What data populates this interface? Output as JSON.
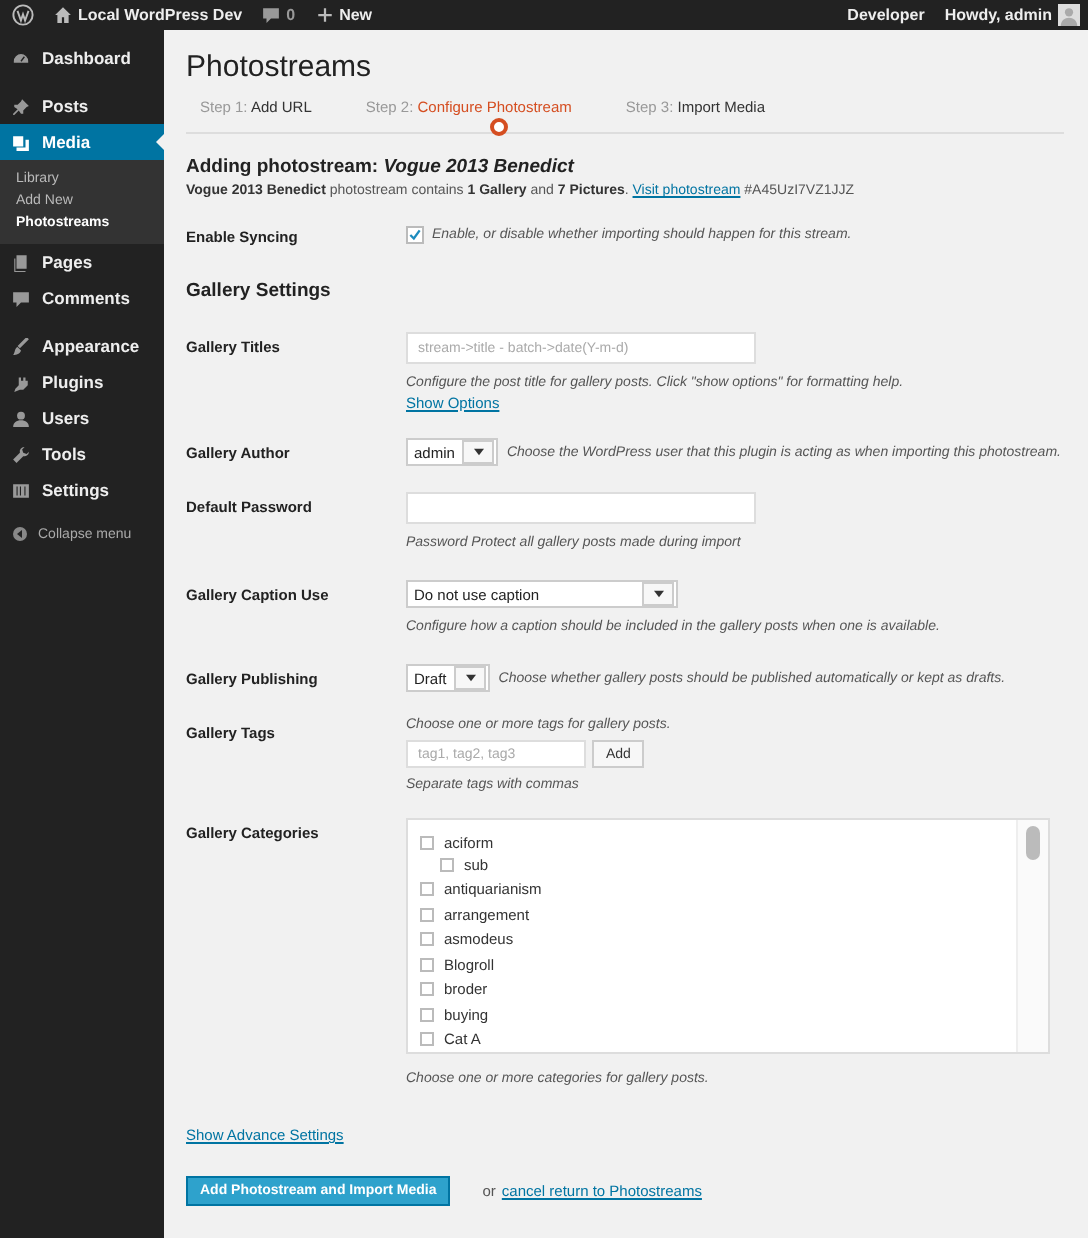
{
  "admin_bar": {
    "site": "Local WordPress Dev",
    "comments": "0",
    "new": "New",
    "environment": "Developer",
    "greeting": "Howdy, admin"
  },
  "sidebar": {
    "groups": [
      [
        {
          "label": "Dashboard",
          "selected": false
        }
      ],
      [
        {
          "label": "Posts",
          "selected": false
        },
        {
          "label": "Media",
          "selected": true,
          "children": [
            {
              "label": "Library",
              "selected": false
            },
            {
              "label": "Add New",
              "selected": false
            },
            {
              "label": "Photostreams",
              "selected": true
            }
          ]
        },
        {
          "label": "Pages",
          "selected": false
        },
        {
          "label": "Comments",
          "selected": false
        }
      ],
      [
        {
          "label": "Appearance",
          "selected": false
        },
        {
          "label": "Plugins",
          "selected": false
        },
        {
          "label": "Users",
          "selected": false
        },
        {
          "label": "Tools",
          "selected": false
        },
        {
          "label": "Settings",
          "selected": false
        }
      ]
    ],
    "collapse": "Collapse menu"
  },
  "page": {
    "title": "Photostreams",
    "steps": [
      {
        "prefix": "Step 1:",
        "label": "Add URL",
        "selected": false
      },
      {
        "prefix": "Step 2:",
        "label": "Configure Photostream",
        "selected": true
      },
      {
        "prefix": "Step 3:",
        "label": "Import Media",
        "selected": false
      }
    ],
    "heading": "Adding photostream: *Vogue 2013 Benedict*",
    "summary": "**Vogue 2013 Benedict** photostream contains **1 Gallery** and **7 Pictures**.",
    "summary_link": "Visit photostream",
    "stream_id": "#A45UzI7VZ1JJZ",
    "settings": [
      {
        "kind": "checkbox",
        "label": "Enable Syncing",
        "checked": true,
        "help": "Enable, or disable whether importing should happen for this stream."
      },
      {
        "kind": "heading",
        "label": "Gallery Settings"
      },
      {
        "kind": "text",
        "label": "Gallery Titles",
        "placeholder": "stream->title - batch->date(Y-m-d)",
        "help": "Configure the post title for gallery posts. Click \"show options\" for formatting help.",
        "link": "Show Options"
      },
      {
        "kind": "select",
        "label": "Gallery Author",
        "value": "admin",
        "help": "Choose the WordPress user that this plugin is acting as when importing this photostream."
      },
      {
        "kind": "text",
        "label": "Default Password",
        "help": "Password Protect all gallery posts made during import"
      },
      {
        "kind": "wide-select",
        "label": "Gallery Caption Use",
        "value": "Do not use caption",
        "help": "Configure how a caption should be included in the gallery posts when one is available."
      },
      {
        "kind": "select",
        "label": "Gallery Publishing",
        "value": "Draft",
        "help": "Choose whether gallery posts should be published automatically or kept as drafts."
      },
      {
        "kind": "tags",
        "label": "Gallery Tags",
        "intro": "Choose one or more tags for gallery posts.",
        "placeholder": "tag1, tag2, tag3",
        "button": "Add",
        "help": "Separate tags with commas"
      },
      {
        "kind": "categories",
        "label": "Gallery Categories",
        "help": "Choose one or more categories for gallery posts.",
        "categories": [
          {
            "label": "aciform",
            "checked": false,
            "children": [
              {
                "label": "sub",
                "checked": false
              }
            ]
          },
          {
            "label": "antiquarianism",
            "checked": false
          },
          {
            "label": "arrangement",
            "checked": false
          },
          {
            "label": "asmodeus",
            "checked": false
          },
          {
            "label": "Blogroll",
            "checked": false
          },
          {
            "label": "broder",
            "checked": false
          },
          {
            "label": "buying",
            "checked": false
          },
          {
            "label": "Cat A",
            "checked": false
          }
        ]
      }
    ],
    "advanced_link": "Show Advance Settings",
    "submit": "Add Photostream and Import Media",
    "or": "or",
    "cancel_link": "cancel return to Photostreams"
  }
}
